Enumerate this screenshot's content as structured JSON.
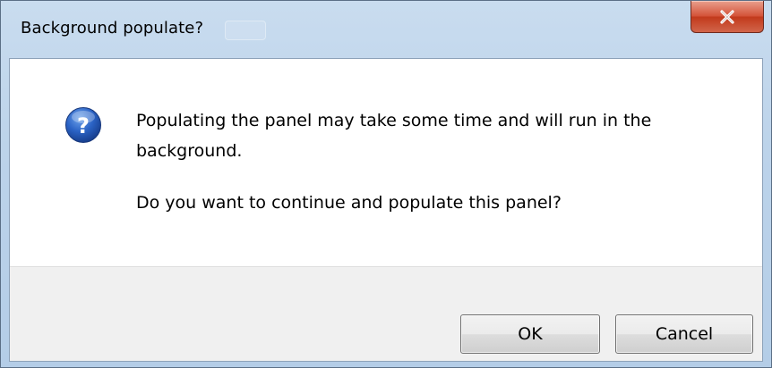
{
  "window": {
    "title": "Background populate?"
  },
  "dialog": {
    "icon": "question-icon",
    "message_line1": "Populating the panel may take some time and will run in the background.",
    "message_line2": "Do you want to continue and populate this panel?"
  },
  "buttons": {
    "ok_label": "OK",
    "cancel_label": "Cancel"
  },
  "colors": {
    "titlebar": "#bcd3ea",
    "close_button": "#c23a1c",
    "icon_blue": "#1e58b8",
    "footer": "#f0f0f0"
  }
}
